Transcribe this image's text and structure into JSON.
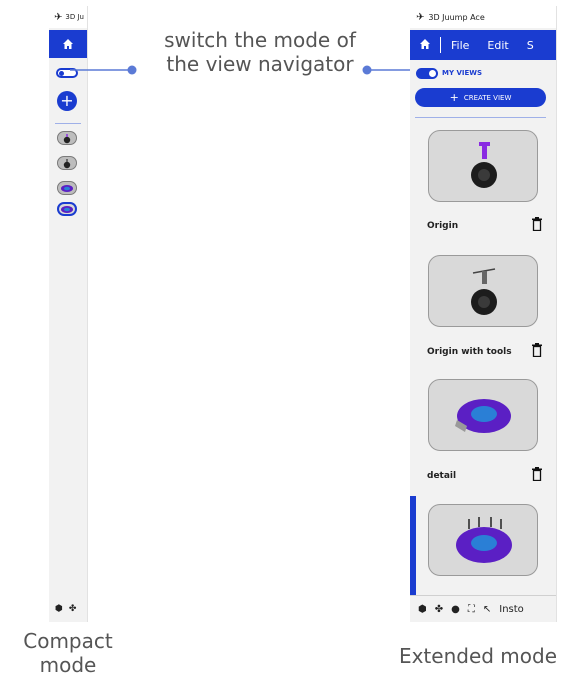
{
  "annotation": {
    "line1": "switch the mode of",
    "line2": "the view navigator"
  },
  "compact": {
    "caption_line1": "Compact",
    "caption_line2": "mode",
    "title": "3D Ju"
  },
  "extended": {
    "caption": "Extended mode",
    "title": "3D Juump Ace",
    "menu": [
      "File",
      "Edit",
      "S"
    ],
    "toggle_label": "MY VIEWS",
    "create_view_label": "CREATE VIEW",
    "views": [
      {
        "name": "Origin"
      },
      {
        "name": "Origin with tools"
      },
      {
        "name": "detail"
      },
      {
        "name": ""
      }
    ],
    "status_text": "Insto"
  },
  "colors": {
    "accent": "#1a3cd0",
    "panel_bg": "#f2f2f2",
    "card_bg": "#d9d9d9"
  },
  "icons": [
    "logo-icon",
    "home-icon",
    "plus-icon",
    "trash-icon",
    "cursor-icon",
    "cube-icon",
    "sphere-icon",
    "fit-icon"
  ]
}
